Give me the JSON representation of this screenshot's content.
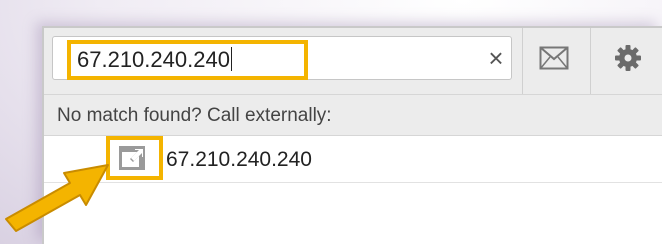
{
  "search": {
    "value": "67.210.240.240",
    "clear_symbol": "×"
  },
  "toolbar": {
    "email_icon": "envelope-icon",
    "settings_icon": "gear-icon"
  },
  "status": {
    "no_match_text": "No match found? Call externally:"
  },
  "results": [
    {
      "number": "67.210.240.240",
      "icon": "external-call-icon"
    }
  ],
  "colors": {
    "highlight": "#f4b400",
    "arrow": "#f4b400",
    "toolbar_bg": "#ececec"
  }
}
